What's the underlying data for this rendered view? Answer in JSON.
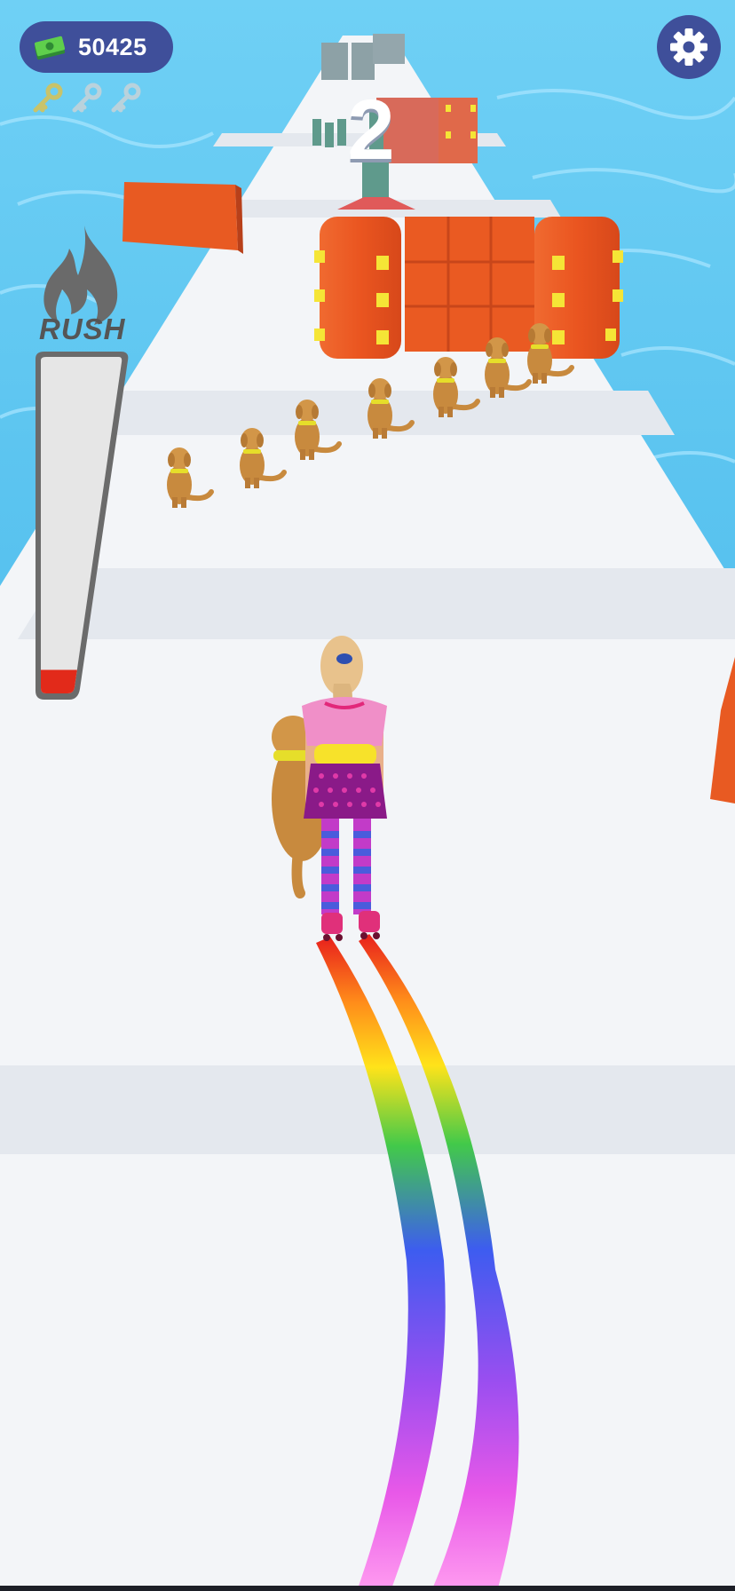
{
  "hud": {
    "currency": {
      "amount": "50425",
      "icon": "cash-stack-icon"
    },
    "keys": {
      "collected": 0,
      "total": 3,
      "icon": "key-icon"
    },
    "settings": {
      "icon": "gear-icon"
    },
    "rush": {
      "label": "RUSH",
      "icon": "flame-icon",
      "fill_fraction": 0.07
    }
  },
  "track": {
    "gate_number": "2",
    "pets_on_track": 8,
    "pet_kind": "golden-retriever"
  },
  "colors": {
    "hud_pill": "#3f4f9a",
    "water": "#3fb8ec",
    "track": "#f3f5f8",
    "wall": "#ee5a24",
    "stud": "#f5e536",
    "rush_fill": "#e22a1a"
  }
}
